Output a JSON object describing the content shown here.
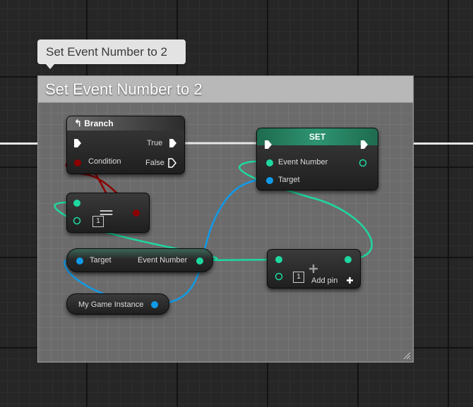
{
  "tooltip": {
    "text": "Set Event Number to 2"
  },
  "comment": {
    "title": "Set Event Number to 2"
  },
  "branch_node": {
    "title": "Branch",
    "condition_label": "Condition",
    "true_label": "True",
    "false_label": "False"
  },
  "equal_node": {
    "operator": "==",
    "literal": "1"
  },
  "set_node": {
    "title": "SET",
    "event_number_label": "Event Number",
    "target_label": "Target"
  },
  "get_event_number_node": {
    "target_label": "Target",
    "output_label": "Event Number"
  },
  "add_node": {
    "literal": "1",
    "add_pin_label": "Add pin"
  },
  "instance_node": {
    "label": "My Game Instance"
  },
  "colors": {
    "exec": "#ffffff",
    "boolean": "#8c0000",
    "integer": "#1ed8a0",
    "object": "#0f9be8",
    "comment_header": "#b8b8b8"
  }
}
